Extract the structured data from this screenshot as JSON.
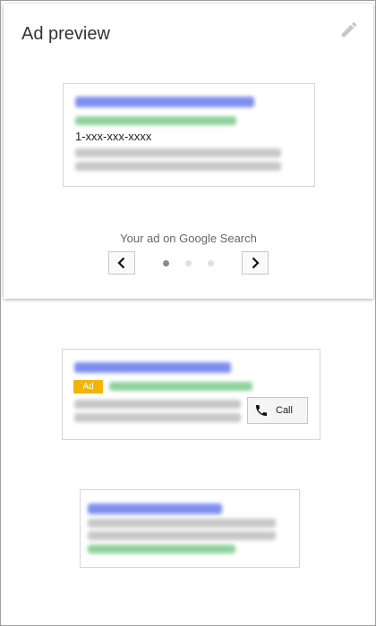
{
  "header": {
    "title": "Ad preview",
    "edit_icon": "pencil-icon"
  },
  "preview1": {
    "phone": "1-xxx-xxx-xxxx"
  },
  "carousel": {
    "caption": "Your ad on Google Search",
    "prev_icon": "chevron-left-icon",
    "next_icon": "chevron-right-icon",
    "dots": 3,
    "active_dot": 1
  },
  "preview2": {
    "badge": "Ad",
    "call_label": "Call",
    "call_icon": "phone-icon"
  },
  "colors": {
    "ad_badge": "#f4b400",
    "link_blue": "#7e8ef0",
    "url_green": "#8fd29c"
  }
}
